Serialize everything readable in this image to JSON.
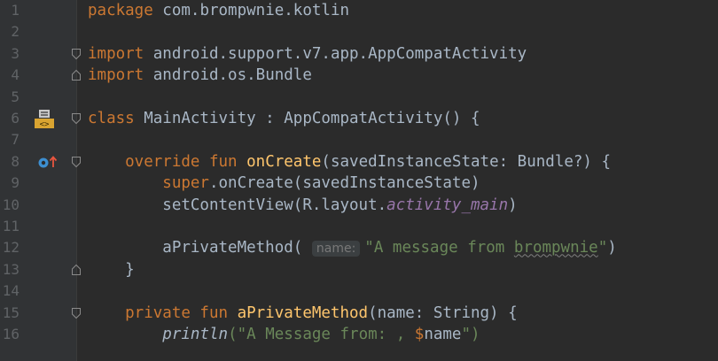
{
  "editor": {
    "lines": [
      {
        "num": "1",
        "tokens": [
          {
            "t": "package ",
            "c": "kw"
          },
          {
            "t": "com.brompwnie.kotlin",
            "c": ""
          }
        ]
      },
      {
        "num": "2",
        "tokens": []
      },
      {
        "num": "3",
        "tokens": [
          {
            "t": "import ",
            "c": "kw"
          },
          {
            "t": "android.support.v7.app.AppCompatActivity",
            "c": ""
          }
        ]
      },
      {
        "num": "4",
        "tokens": [
          {
            "t": "import ",
            "c": "kw"
          },
          {
            "t": "android.os.Bundle",
            "c": ""
          }
        ]
      },
      {
        "num": "5",
        "tokens": []
      },
      {
        "num": "6",
        "tokens": [
          {
            "t": "class ",
            "c": "kw"
          },
          {
            "t": "MainActivity : AppCompatActivity() {",
            "c": ""
          }
        ]
      },
      {
        "num": "7",
        "tokens": []
      },
      {
        "num": "8",
        "tokens": [
          {
            "t": "    override fun ",
            "c": "kw"
          },
          {
            "t": "onCreate",
            "c": "fn"
          },
          {
            "t": "(savedInstanceState: Bundle?) {",
            "c": ""
          }
        ]
      },
      {
        "num": "9",
        "tokens": [
          {
            "t": "        super",
            "c": "kw"
          },
          {
            "t": ".onCreate(savedInstanceState)",
            "c": ""
          }
        ]
      },
      {
        "num": "10",
        "tokens": [
          {
            "t": "        setContentView(R.layout.",
            "c": ""
          },
          {
            "t": "activity_main",
            "c": "ital"
          },
          {
            "t": ")",
            "c": ""
          }
        ]
      },
      {
        "num": "11",
        "tokens": []
      },
      {
        "num": "12",
        "tokens": [
          {
            "t": "        aPrivateMethod( ",
            "c": ""
          },
          {
            "t": "name:",
            "c": "hint"
          },
          {
            "t": "\"A message from ",
            "c": "str"
          },
          {
            "t": "brompwnie",
            "c": "str squiggle"
          },
          {
            "t": "\"",
            "c": "str"
          },
          {
            "t": ")",
            "c": ""
          }
        ]
      },
      {
        "num": "13",
        "tokens": [
          {
            "t": "    }",
            "c": ""
          }
        ]
      },
      {
        "num": "14",
        "tokens": []
      },
      {
        "num": "15",
        "tokens": [
          {
            "t": "    private fun ",
            "c": "kw"
          },
          {
            "t": "aPrivateMethod",
            "c": "fn"
          },
          {
            "t": "(name: String) {",
            "c": ""
          }
        ]
      },
      {
        "num": "16",
        "tokens": [
          {
            "t": "        ",
            "c": ""
          },
          {
            "t": "println",
            "c": "fnital"
          },
          {
            "t": "(\"A Message from: , ",
            "c": "str"
          },
          {
            "t": "$",
            "c": "kw"
          },
          {
            "t": "name",
            "c": ""
          },
          {
            "t": "\")",
            "c": "str"
          }
        ]
      }
    ],
    "fold_markers": [
      {
        "line": 3,
        "type": "open"
      },
      {
        "line": 4,
        "type": "close"
      },
      {
        "line": 6,
        "type": "open"
      },
      {
        "line": 8,
        "type": "open"
      },
      {
        "line": 13,
        "type": "close"
      },
      {
        "line": 15,
        "type": "open"
      }
    ],
    "gutter_icons": [
      {
        "line": 6,
        "name": "android-layout-icon"
      },
      {
        "line": 8,
        "name": "override-method-icon"
      }
    ]
  },
  "colors": {
    "background": "#2b2b2b",
    "gutter": "#313335",
    "line_number": "#606366",
    "keyword": "#cc7832",
    "function": "#ffc66d",
    "string": "#6a8759",
    "property": "#9876aa",
    "default": "#a9b7c6"
  }
}
